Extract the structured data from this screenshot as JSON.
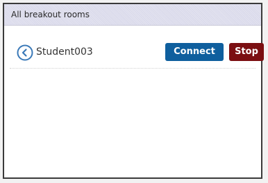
{
  "header": {
    "title": "All breakout rooms"
  },
  "room": {
    "student_name": "Student003",
    "connect_label": "Connect",
    "stop_label": "Stop"
  },
  "colors": {
    "connect_button": "#0f5f9e",
    "stop_button": "#7b0f12",
    "back_icon": "#3a79b8"
  },
  "icons": {
    "back": "chevron-left-icon"
  }
}
